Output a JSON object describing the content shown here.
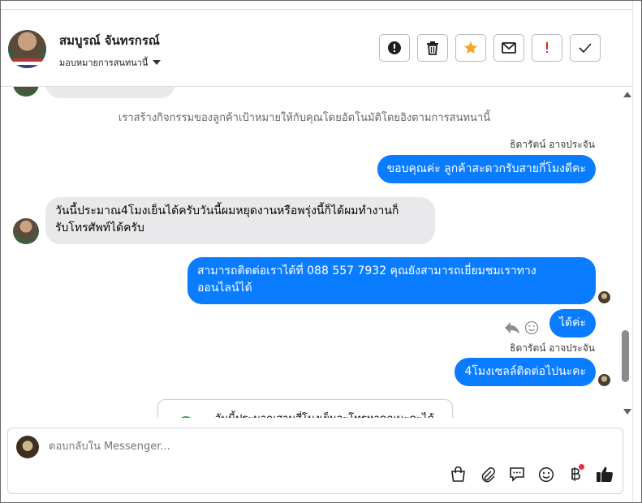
{
  "header": {
    "contact_name": "สมบูรณ์ จันทรกรณ์",
    "assign_label": "มอบหมายการสนทนานี้",
    "actions": [
      {
        "name": "spam-button",
        "icon": "exclamation-circle-icon"
      },
      {
        "name": "delete-button",
        "icon": "trash-icon"
      },
      {
        "name": "star-button",
        "icon": "star-icon",
        "color": "#f5a623"
      },
      {
        "name": "mark-unread-button",
        "icon": "envelope-icon"
      },
      {
        "name": "follow-up-button",
        "icon": "exclamation-icon",
        "color": "#e02020"
      },
      {
        "name": "done-button",
        "icon": "check-icon"
      }
    ]
  },
  "chat": {
    "system_notice": "เราสร้างกิจกรรมของลูกค้าเป้าหมายให้กับคุณโดยอัตโนมัติโดยอิงตามการสนทนานี้",
    "messages": [
      {
        "sender": "ธิดารัตน์ อาจประจัน",
        "direction": "out",
        "text": "ขอบคุณค่ะ ลูกค้าสะดวกรับสายกี่โมงดีคะ"
      },
      {
        "direction": "in",
        "line1": "วันนี้ประมาณ4โมงเย็นได้ครับวันนี้ผมหยุดงานหรือพรุ่งนี้ก็ได้ผมทำงานก็",
        "line2": "รับโทรศัพท์ได้ครับ"
      },
      {
        "direction": "out",
        "line1": "สามารถติดต่อเราได้ที่ 088 557 7932 คุณยังสามารถเยี่ยมชมเราทาง",
        "line2": "ออนไลน์ได้"
      },
      {
        "direction": "out",
        "text": "ได้ค่ะ"
      },
      {
        "sender": "ธิดารัตน์ อาจประจัน",
        "direction": "out",
        "text": "4โมงเซลล์ติดต่อไปนะคะ"
      }
    ],
    "card_text": "วันนี้ประมาณสามสี่โมงเย็นจะโทรหาคุณนะคะได้ไหม"
  },
  "composer": {
    "placeholder": "ตอบกลับใน Messenger...",
    "icons": [
      "shopping-bag-icon",
      "paperclip-icon",
      "quick-reply-icon",
      "emoji-icon",
      "payment-icon",
      "like-icon"
    ]
  },
  "colors": {
    "outgoing": "#0a7cff",
    "incoming": "#e9e9eb",
    "star": "#f5a623",
    "alert": "#e02020"
  }
}
